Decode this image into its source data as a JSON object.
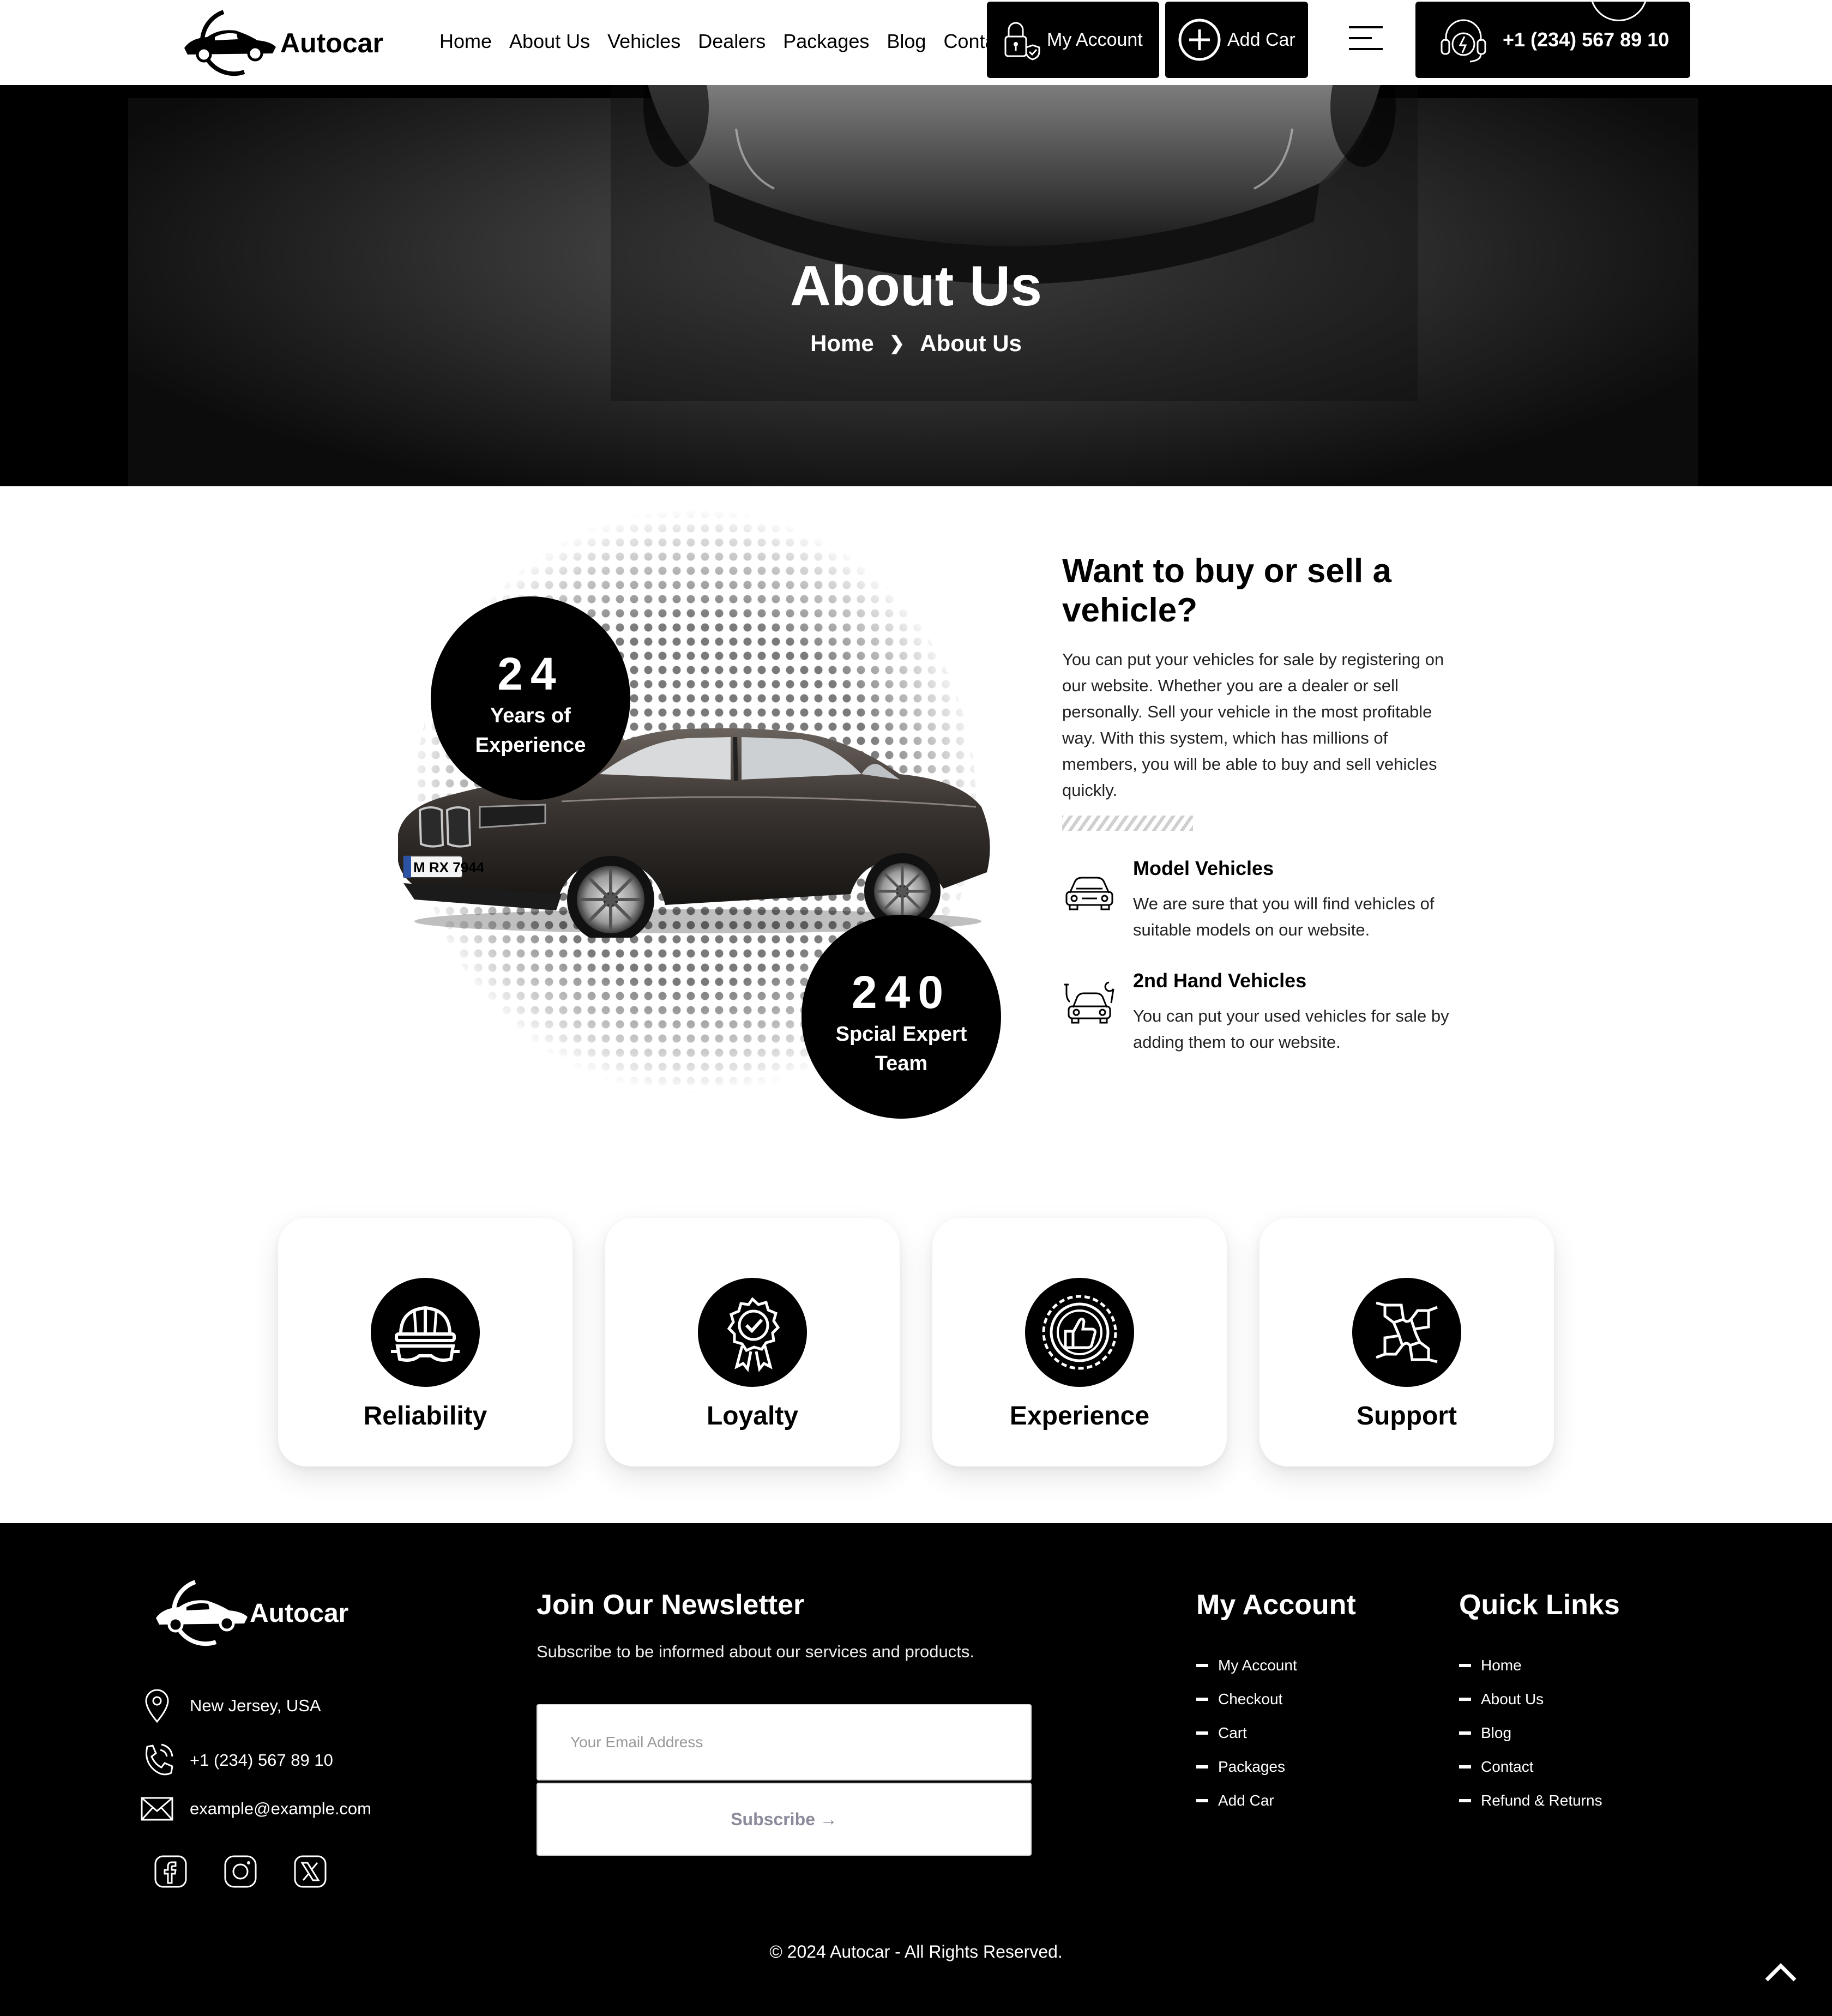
{
  "header": {
    "logo_text": "Autocar",
    "nav": [
      "Home",
      "About Us",
      "Vehicles",
      "Dealers",
      "Packages",
      "Blog",
      "Contact"
    ],
    "account_label": "My Account",
    "addcar_label": "Add Car",
    "phone": "+1 (234) 567 89 10"
  },
  "hero": {
    "title": "About Us",
    "breadcrumb_home": "Home",
    "breadcrumb_current": "About Us"
  },
  "about": {
    "stat1": {
      "number": "24",
      "label_line1": "Years of",
      "label_line2": "Experience"
    },
    "stat2": {
      "number": "240",
      "label_line1": "Spcial Expert",
      "label_line2": "Team"
    },
    "plate": "M RX 7944",
    "title": "Want to buy or sell a vehicle?",
    "paragraph": "You can put your vehicles for sale by registering on our website. Whether you are a dealer or sell personally. Sell your vehicle in the most profitable way. With this system, which has millions of members, you will be able to buy and sell vehicles quickly.",
    "features": [
      {
        "icon": "car-front-icon",
        "title": "Model Vehicles",
        "desc": "We are sure that you will find vehicles of suitable models on our website."
      },
      {
        "icon": "car-repair-icon",
        "title": "2nd Hand Vehicles",
        "desc": "You can put your used vehicles for sale by adding them to our website."
      }
    ]
  },
  "values": [
    {
      "icon": "hardhat-goggles-icon",
      "label": "Reliability"
    },
    {
      "icon": "award-badge-icon",
      "label": "Loyalty"
    },
    {
      "icon": "thumbs-up-seal-icon",
      "label": "Experience"
    },
    {
      "icon": "joined-hands-icon",
      "label": "Support"
    }
  ],
  "footer": {
    "logo_text": "Autocar",
    "address": "New Jersey, USA",
    "phone": "+1 (234) 567 89 10",
    "email": "example@example.com",
    "socials": [
      "facebook-icon",
      "instagram-icon",
      "x-icon"
    ],
    "newsletter_title": "Join Our Newsletter",
    "newsletter_sub": "Subscribe to be informed about our services and products.",
    "email_placeholder": "Your Email Address",
    "subscribe_label": "Subscribe →",
    "account_title": "My Account",
    "account_links": [
      "My Account",
      "Checkout",
      "Cart",
      "Packages",
      "Add Car"
    ],
    "quick_title": "Quick Links",
    "quick_links": [
      "Home",
      "About Us",
      "Blog",
      "Contact",
      "Refund & Returns"
    ],
    "copyright": "© 2024 Autocar - All Rights Reserved."
  }
}
